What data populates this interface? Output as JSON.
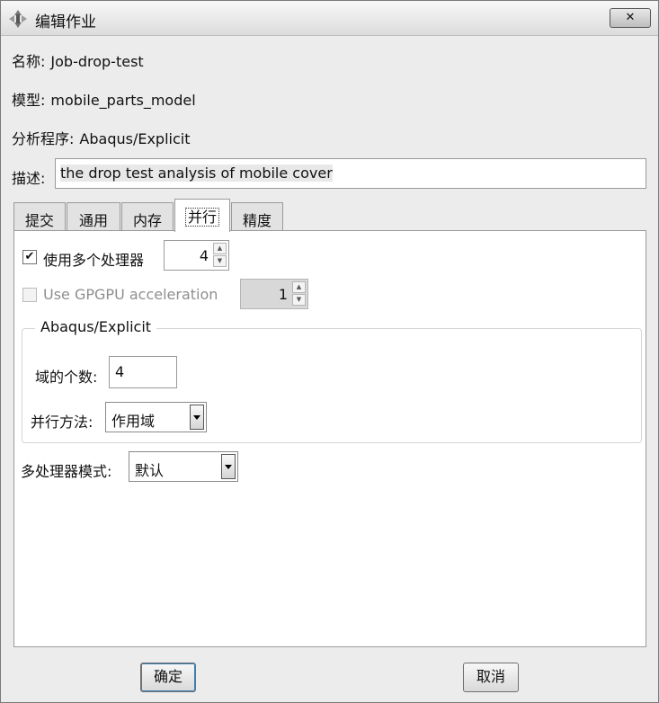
{
  "window": {
    "title": "编辑作业",
    "close_label": "✕"
  },
  "job": {
    "name_label": "名称:",
    "name_value": "Job-drop-test",
    "model_label": "模型:",
    "model_value": "mobile_parts_model",
    "program_label": "分析程序:",
    "program_value": "Abaqus/Explicit",
    "description_label": "描述:",
    "description_value": "the drop test analysis of mobile cover"
  },
  "tabs": [
    {
      "label": "提交",
      "active": false
    },
    {
      "label": "通用",
      "active": false
    },
    {
      "label": "内存",
      "active": false
    },
    {
      "label": "并行",
      "active": true
    },
    {
      "label": "精度",
      "active": false
    }
  ],
  "parallel": {
    "use_multiple_processors_label": "使用多个处理器",
    "use_multiple_processors_checked": true,
    "processors_value": "4",
    "gpgpu_label": "Use GPGPU acceleration",
    "gpgpu_checked": false,
    "gpgpu_value": "1",
    "explicit_group_title": "Abaqus/Explicit",
    "domains_label": "域的个数:",
    "domains_value": "4",
    "method_label": "并行方法:",
    "method_value": "作用域",
    "multiprocessing_mode_label": "多处理器模式:",
    "multiprocessing_mode_value": "默认"
  },
  "buttons": {
    "ok_label": "确定",
    "cancel_label": "取消"
  }
}
